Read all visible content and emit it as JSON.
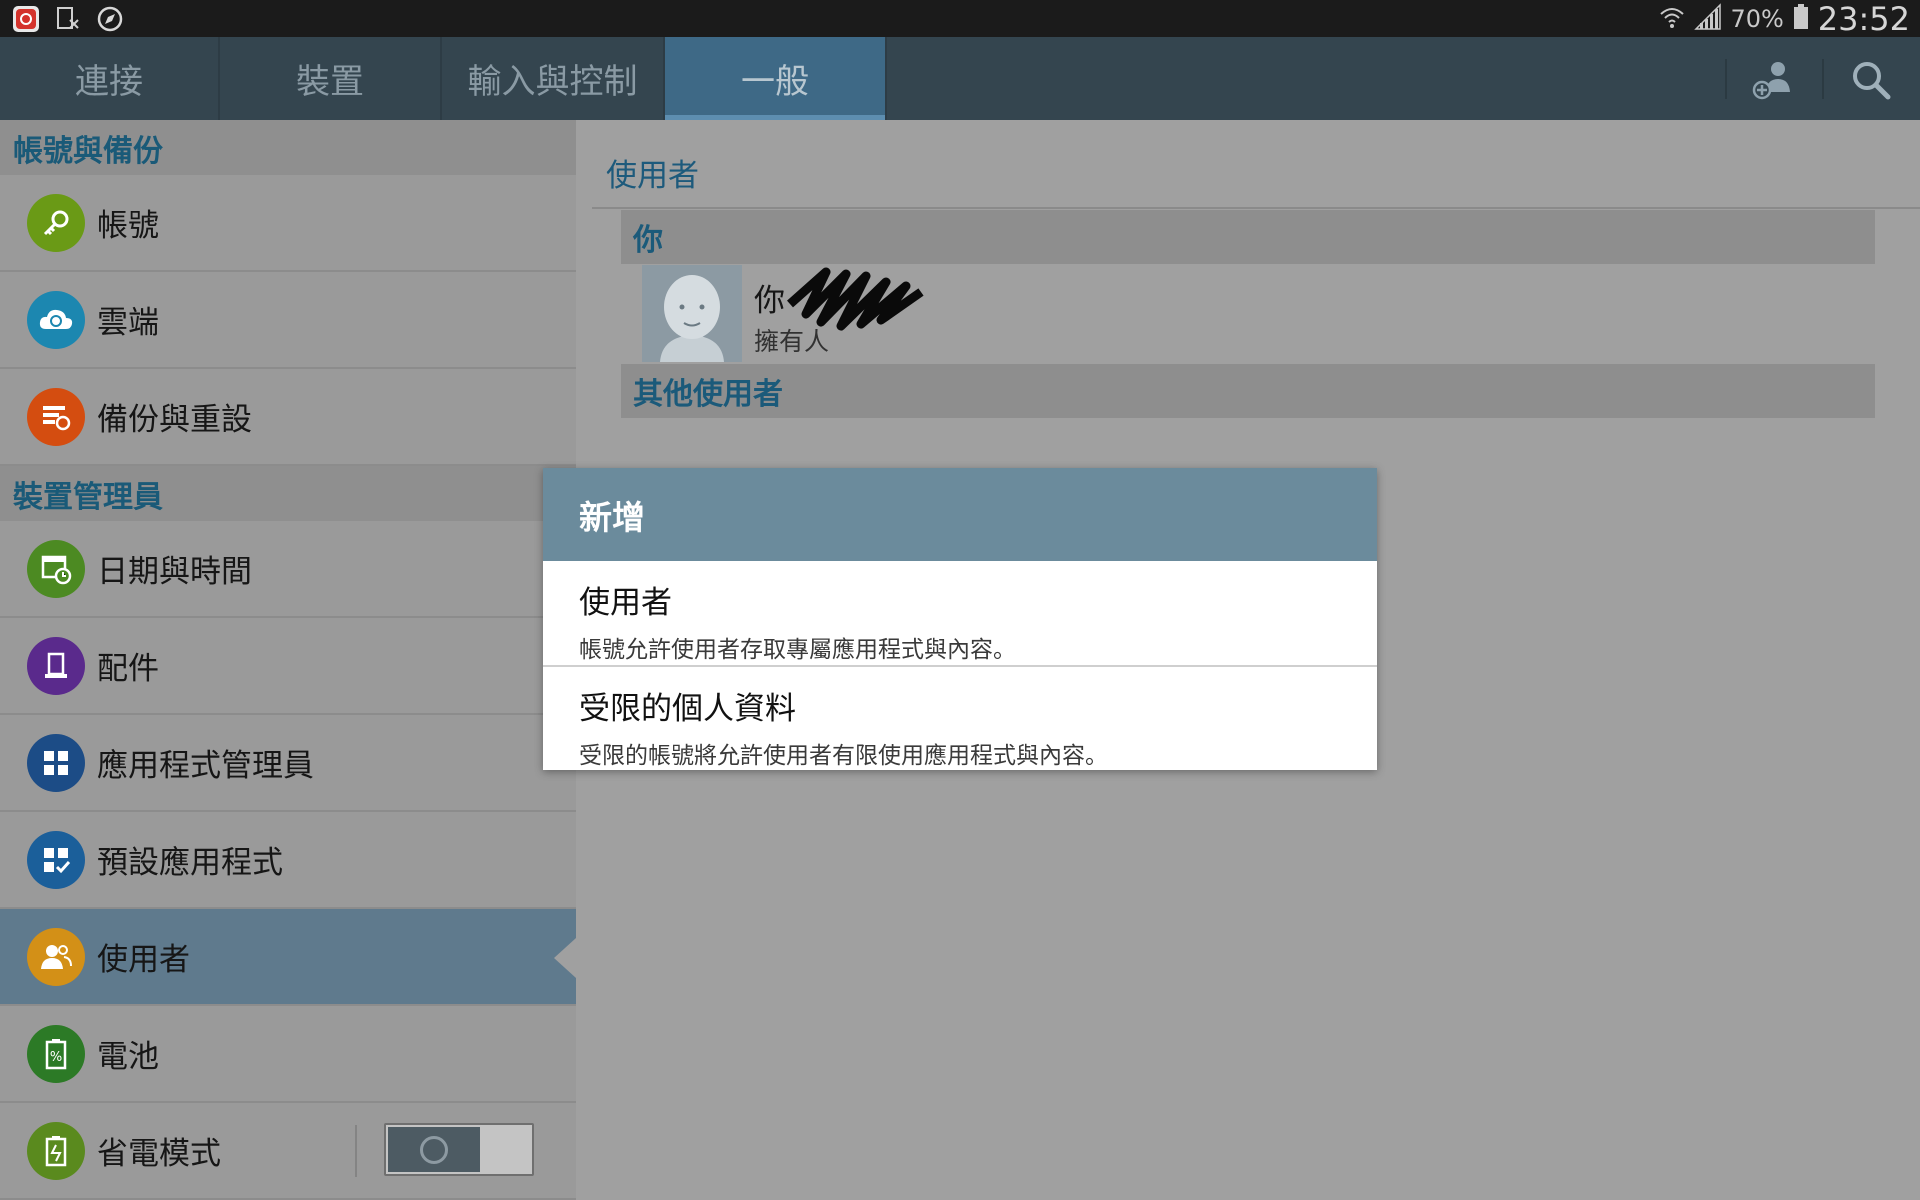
{
  "status_bar": {
    "battery_percent": "70%",
    "time": "23:52",
    "icons": [
      "notification-app-icon",
      "document-icon",
      "compass-icon",
      "wifi-icon",
      "signal-icon",
      "battery-icon"
    ]
  },
  "tabs": [
    {
      "label": "連接",
      "active": false
    },
    {
      "label": "裝置",
      "active": false
    },
    {
      "label": "輸入與控制",
      "active": false
    },
    {
      "label": "一般",
      "active": true
    }
  ],
  "toolbar_actions": [
    "add-user-icon",
    "search-icon"
  ],
  "sidebar": {
    "sections": [
      {
        "header": "帳號與備份",
        "items": [
          {
            "label": "帳號",
            "icon": "key-icon",
            "color": "#6a9a16"
          },
          {
            "label": "雲端",
            "icon": "cloud-sync-icon",
            "color": "#1c87b0"
          },
          {
            "label": "備份與重設",
            "icon": "backup-icon",
            "color": "#d44d10"
          }
        ]
      },
      {
        "header": "裝置管理員",
        "items": [
          {
            "label": "日期與時間",
            "icon": "calendar-clock-icon",
            "color": "#4c8a22"
          },
          {
            "label": "配件",
            "icon": "accessory-icon",
            "color": "#5a2a8c"
          },
          {
            "label": "應用程式管理員",
            "icon": "apps-grid-icon",
            "color": "#1c4c86"
          },
          {
            "label": "預設應用程式",
            "icon": "default-apps-icon",
            "color": "#1b5f9a"
          },
          {
            "label": "使用者",
            "icon": "users-icon",
            "color": "#d39017",
            "selected": true
          },
          {
            "label": "電池",
            "icon": "battery-percent-icon",
            "color": "#2c7a26"
          },
          {
            "label": "省電模式",
            "icon": "power-saving-icon",
            "color": "#5a8a1e",
            "toggle": "off"
          }
        ]
      }
    ]
  },
  "main": {
    "title": "使用者",
    "you_header": "你",
    "current_user": {
      "name": "你",
      "role": "擁有人"
    },
    "others_header": "其他使用者"
  },
  "dialog": {
    "title": "新增",
    "options": [
      {
        "title": "使用者",
        "description": "帳號允許使用者存取專屬應用程式與內容。"
      },
      {
        "title": "受限的個人資料",
        "description": "受限的帳號將允許使用者有限使用應用程式與內容。"
      }
    ]
  }
}
